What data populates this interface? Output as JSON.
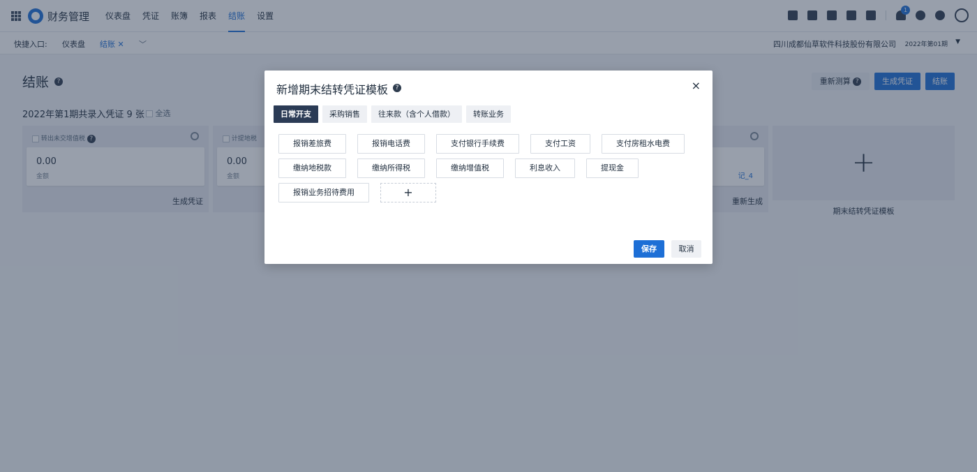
{
  "app": {
    "title": "财务管理",
    "notifications_count": "1"
  },
  "nav": [
    "仪表盘",
    "凭证",
    "账簿",
    "报表",
    "结账",
    "设置"
  ],
  "quickbar": {
    "label": "快捷入口:",
    "links": [
      {
        "label": "仪表盘"
      },
      {
        "label": "结账"
      }
    ],
    "company": "四川成都仙草软件科技股份有限公司",
    "period": "2022年第01期"
  },
  "page": {
    "title": "结账",
    "summary": "2022年第1期共录入凭证 9 张",
    "select_all": "全选",
    "btn_recalc": "重新测算",
    "btn_generate": "生成凭证",
    "btn_close": "结账",
    "cards": [
      {
        "title": "转出未交增值税",
        "amount": "0.00",
        "amount_label": "金额",
        "action": "生成凭证",
        "link": ""
      },
      {
        "title": "计提地税",
        "amount": "0.00",
        "amount_label": "金额",
        "action": "",
        "link": ""
      },
      {
        "title": "",
        "amount": "",
        "amount_label": "",
        "action": "重新生成",
        "link": "记_4"
      }
    ],
    "add_template_label": "期末结转凭证模板"
  },
  "modal": {
    "title": "新增期末结转凭证模板",
    "close": "×",
    "tabs": [
      "日常开支",
      "采购销售",
      "往来款（含个人借款）",
      "转账业务"
    ],
    "active_tab": 0,
    "templates": [
      [
        "报销差旅费",
        "报销电话费",
        "支付银行手续费",
        "支付工资",
        "支付房租水电费"
      ],
      [
        "缴纳地税款",
        "缴纳所得税",
        "缴纳增值税",
        "利息收入",
        "提现金"
      ],
      [
        "报销业务招待费用"
      ]
    ],
    "add": "+",
    "save": "保存",
    "cancel": "取消"
  }
}
